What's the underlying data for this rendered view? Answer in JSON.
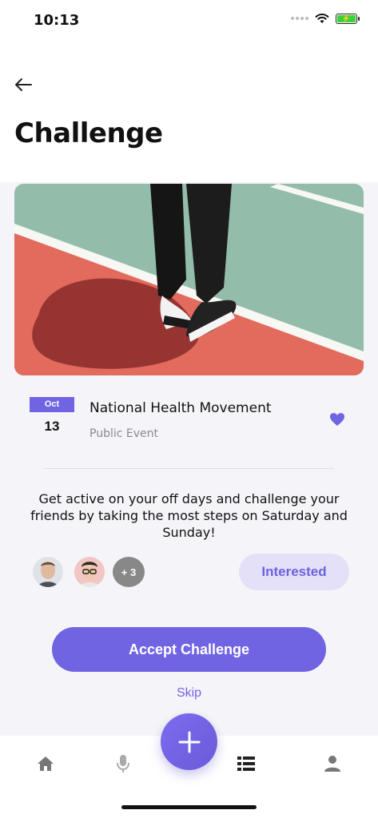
{
  "status_bar": {
    "time": "10:13"
  },
  "header": {
    "title": "Challenge"
  },
  "event": {
    "month": "Oct",
    "day": "13",
    "title": "National Health Movement",
    "type": "Public Event",
    "description": "Get active on your off days and challenge your friends by taking the most steps on Saturday and Sunday!"
  },
  "participants": {
    "more_label": "+ 3"
  },
  "actions": {
    "interested_label": "Interested",
    "accept_label": "Accept Challenge",
    "skip_label": "Skip"
  },
  "tab_bar": {
    "items": [
      {
        "icon": "home-icon"
      },
      {
        "icon": "microphone-icon"
      },
      {
        "icon": "plus-icon"
      },
      {
        "icon": "list-icon"
      },
      {
        "icon": "profile-icon"
      }
    ]
  },
  "colors": {
    "accent": "#7064E3",
    "accent_light": "#E3E0F7",
    "heart": "#7064E3"
  }
}
